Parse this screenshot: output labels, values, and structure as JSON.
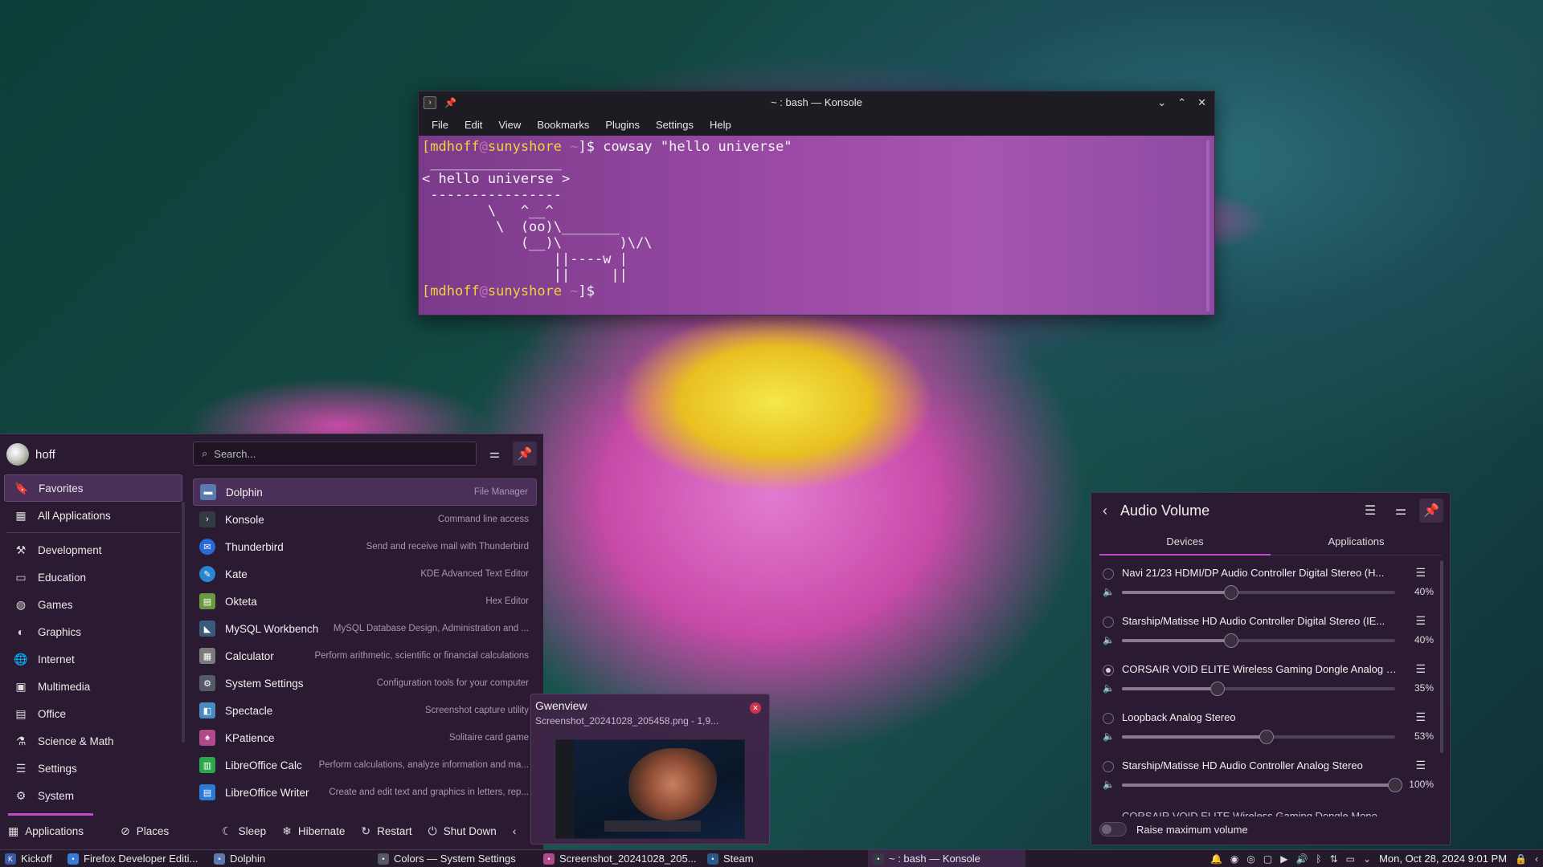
{
  "konsole": {
    "title": "~ : bash — Konsole",
    "menu": [
      "File",
      "Edit",
      "View",
      "Bookmarks",
      "Plugins",
      "Settings",
      "Help"
    ],
    "prompt": {
      "open": "[",
      "user": "mdhoff",
      "at": "@",
      "host": "sunyshore",
      "path": " ~",
      "close": "]$"
    },
    "command": " cowsay \"hello universe\"",
    "output": " ________________\n< hello universe >\n ----------------\n        \\   ^__^\n         \\  (oo)\\_______\n            (__)\\       )\\/\\\n                ||----w |\n                ||     ||"
  },
  "kickoff": {
    "username": "hoff",
    "search_placeholder": "Search...",
    "categories": [
      {
        "label": "Favorites",
        "icon": "bookmark-icon"
      },
      {
        "label": "All Applications",
        "icon": "grid-icon"
      },
      {
        "label": "Development",
        "icon": "hammer-icon"
      },
      {
        "label": "Education",
        "icon": "education-icon"
      },
      {
        "label": "Games",
        "icon": "gamepad-icon"
      },
      {
        "label": "Graphics",
        "icon": "palette-icon"
      },
      {
        "label": "Internet",
        "icon": "globe-icon"
      },
      {
        "label": "Multimedia",
        "icon": "media-icon"
      },
      {
        "label": "Office",
        "icon": "document-icon"
      },
      {
        "label": "Science & Math",
        "icon": "flask-icon"
      },
      {
        "label": "Settings",
        "icon": "sliders-icon"
      },
      {
        "label": "System",
        "icon": "gear-icon"
      }
    ],
    "apps": [
      {
        "name": "Dolphin",
        "desc": "File Manager",
        "color": "#5a7ab0"
      },
      {
        "name": "Konsole",
        "desc": "Command line access",
        "color": "#333a44"
      },
      {
        "name": "Thunderbird",
        "desc": "Send and receive mail with Thunderbird",
        "color": "#2a6ad8"
      },
      {
        "name": "Kate",
        "desc": "KDE Advanced Text Editor",
        "color": "#2a86d0"
      },
      {
        "name": "Okteta",
        "desc": "Hex Editor",
        "color": "#6a9a40"
      },
      {
        "name": "MySQL Workbench",
        "desc": "MySQL Database Design, Administration and ...",
        "color": "#3a5a7a"
      },
      {
        "name": "Calculator",
        "desc": "Perform arithmetic, scientific or financial calculations",
        "color": "#7a7a7a"
      },
      {
        "name": "System Settings",
        "desc": "Configuration tools for your computer",
        "color": "#555a66"
      },
      {
        "name": "Spectacle",
        "desc": "Screenshot capture utility",
        "color": "#4a8ac0"
      },
      {
        "name": "KPatience",
        "desc": "Solitaire card game",
        "color": "#b04a8a"
      },
      {
        "name": "LibreOffice Calc",
        "desc": "Perform calculations, analyze information and ma...",
        "color": "#2aa84a"
      },
      {
        "name": "LibreOffice Writer",
        "desc": "Create and edit text and graphics in letters, rep...",
        "color": "#2a7ad8"
      }
    ],
    "bottom": {
      "applications": "Applications",
      "places": "Places",
      "sleep": "Sleep",
      "hibernate": "Hibernate",
      "restart": "Restart",
      "shutdown": "Shut Down"
    }
  },
  "notification": {
    "app": "Gwenview",
    "file": "Screenshot_20241028_205458.png - 1,9..."
  },
  "audio": {
    "title": "Audio Volume",
    "tabs": [
      "Devices",
      "Applications"
    ],
    "devices": [
      {
        "name": "Navi 21/23 HDMI/DP Audio Controller Digital Stereo (H...",
        "volume": 40,
        "pct_label": "40%",
        "selected": false
      },
      {
        "name": "Starship/Matisse HD Audio Controller Digital Stereo (IE...",
        "volume": 40,
        "pct_label": "40%",
        "selected": false
      },
      {
        "name": "CORSAIR VOID ELITE Wireless Gaming Dongle Analog S...",
        "volume": 35,
        "pct_label": "35%",
        "selected": true
      },
      {
        "name": "Loopback Analog Stereo",
        "volume": 53,
        "pct_label": "53%",
        "selected": false
      },
      {
        "name": "Starship/Matisse HD Audio Controller Analog Stereo",
        "volume": 100,
        "pct_label": "100%",
        "selected": false
      }
    ],
    "partial_device": "CORSAIR VOID ELITE Wireless Gaming Dongle Mono",
    "raise_max_label": "Raise maximum volume"
  },
  "taskbar": {
    "kickoff": "Kickoff",
    "tasks": [
      {
        "label": "Firefox Developer Editi...",
        "color": "#3a7ad8"
      },
      {
        "label": "Dolphin",
        "color": "#5a7ab0"
      },
      {
        "label": "Colors — System Settings",
        "color": "#555a66"
      },
      {
        "label": "Screenshot_20241028_205...",
        "color": "#b04a8a"
      },
      {
        "label": "Steam",
        "color": "#2a5a8a"
      },
      {
        "label": "~ : bash — Konsole",
        "color": "#333a44"
      }
    ],
    "clock": "Mon, Oct 28, 2024 9:01 PM"
  }
}
